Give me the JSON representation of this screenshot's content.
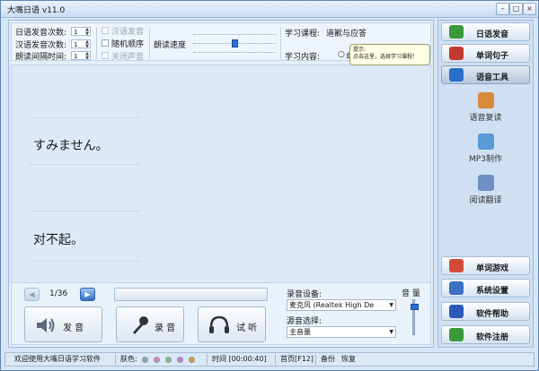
{
  "app": {
    "title": "大嘴日语 v11.0",
    "window_buttons": {
      "min": "–",
      "max": "□",
      "close": "×"
    }
  },
  "settings": {
    "jp_count_label": "日语发音次数:",
    "jp_count_value": "1",
    "cn_count_label": "汉语发音次数:",
    "cn_count_value": "1",
    "interval_label": "朗读间隔时间:",
    "interval_value": "1",
    "chk_cn_voice": "汉语发音",
    "chk_random": "随机顺序",
    "chk_mute": "关闭声音",
    "speed_label": "朗读速度",
    "speed_level": 0.5,
    "course_label": "学习课程:",
    "course_value": "道歉与应答",
    "content_label": "学习内容:",
    "content_option": "单"
  },
  "tooltip": {
    "title": "提示:",
    "text": "点击这里，选择学习课程！"
  },
  "content": {
    "japanese": "すみません。",
    "chinese": "对不起。"
  },
  "controls": {
    "page_indicator": "1/36",
    "prev_icon": "prev-arrow-icon",
    "next_icon": "next-arrow-icon",
    "speak_label": "发 音",
    "record_label": "录 音",
    "listen_label": "试 听",
    "record_device_label": "录音设备:",
    "record_device_value": "麦克风 (Realtek High De",
    "source_label": "源音选择:",
    "source_value": "主音量",
    "volume_label": "音 量",
    "volume_level": 0.85
  },
  "sidebar": {
    "top": [
      {
        "label": "日语发音",
        "icon": "book-icon",
        "color": "#3a9a3a"
      },
      {
        "label": "单词句子",
        "icon": "books-icon",
        "color": "#c33a2e"
      },
      {
        "label": "语音工具",
        "icon": "speaker-icon",
        "color": "#2a6fc9"
      }
    ],
    "tools": [
      {
        "label": "语音复读",
        "icon": "person-icon",
        "color": "#d98a3a"
      },
      {
        "label": "MP3制作",
        "icon": "mp3-icon",
        "color": "#5a9ad8"
      },
      {
        "label": "阅读翻译",
        "icon": "translate-icon",
        "color": "#6f8fc4"
      }
    ],
    "bottom": [
      {
        "label": "单词游戏",
        "icon": "puzzle-icon",
        "color": "#d44a3a"
      },
      {
        "label": "系统设置",
        "icon": "gears-icon",
        "color": "#3a6fc4"
      },
      {
        "label": "软件帮助",
        "icon": "help-icon",
        "color": "#2a5ab8"
      },
      {
        "label": "软件注册",
        "icon": "register-icon",
        "color": "#3a9a3a"
      }
    ]
  },
  "status": {
    "welcome": "欢迎使用大嘴日语学习软件",
    "skin_label": "肤色:",
    "skin_colors": [
      "#8aa0bd",
      "#d686b0",
      "#7fc47f",
      "#c07fd0",
      "#e29a2a"
    ],
    "time": "时间 [00:00:40]",
    "home": "首页[F12]",
    "backup": "备份",
    "restore": "恢复"
  }
}
